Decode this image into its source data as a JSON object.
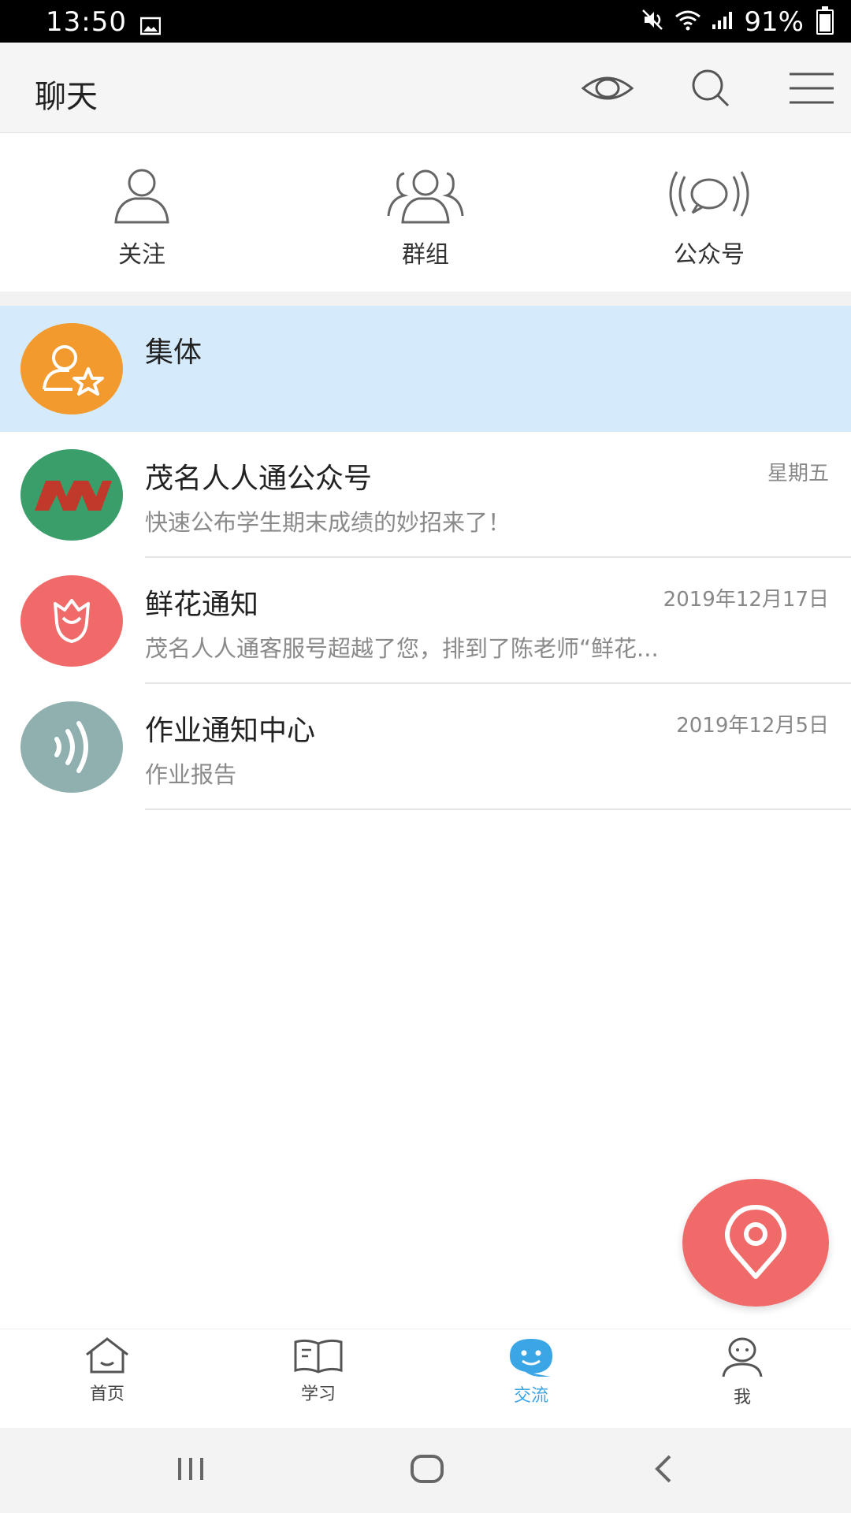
{
  "status_bar": {
    "time": "13:50",
    "battery": "91%"
  },
  "app_bar": {
    "title": "聊天",
    "icons": [
      "eye-icon",
      "search-icon",
      "menu-icon"
    ]
  },
  "quick_actions": [
    {
      "label": "关注",
      "icon": "person-icon"
    },
    {
      "label": "群组",
      "icon": "group-icon"
    },
    {
      "label": "公众号",
      "icon": "broadcast-icon"
    }
  ],
  "conversations": [
    {
      "name": "集体",
      "time": "",
      "preview": "",
      "avatar_color": "#f29a2e",
      "highlighted": true
    },
    {
      "name": "茂名人人通公众号",
      "time": "星期五",
      "preview": "快速公布学生期末成绩的妙招来了！",
      "avatar_color": "#3a9e6a"
    },
    {
      "name": "鲜花通知",
      "time": "2019年12月17日",
      "preview": "茂名人人通客服号超越了您，排到了陈老师“鲜花...",
      "avatar_color": "#f06a6a"
    },
    {
      "name": "作业通知中心",
      "time": "2019年12月5日",
      "preview": "作业报告",
      "avatar_color": "#8fb0ae"
    }
  ],
  "bottom_nav": [
    {
      "label": "首页",
      "icon": "home-icon"
    },
    {
      "label": "学习",
      "icon": "book-icon"
    },
    {
      "label": "交流",
      "icon": "chat-icon",
      "active": true
    },
    {
      "label": "我",
      "icon": "profile-icon"
    }
  ],
  "colors": {
    "accent": "#3aa6e6",
    "highlight_row": "#d5eafb",
    "fab": "#f06a6a"
  }
}
